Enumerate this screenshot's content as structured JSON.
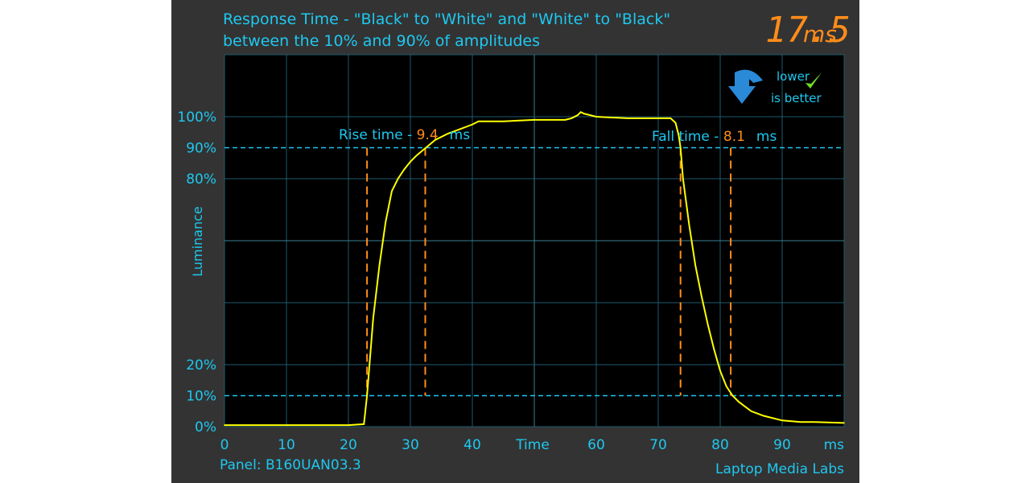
{
  "chart_data": {
    "type": "line",
    "title": "Response Time - \"Black\" to \"White\" and \"White\" to \"Black\"",
    "subtitle": "between the 10% and 90% of amplitudes",
    "xlabel": "Time",
    "xunit": "ms",
    "ylabel": "Luminance",
    "xlim": [
      0,
      100
    ],
    "ylim": [
      0,
      120
    ],
    "x_ticks": [
      "0",
      "10",
      "20",
      "30",
      "40",
      "60",
      "70",
      "80",
      "90"
    ],
    "y_ticks": [
      {
        "v": 0,
        "label": "0%"
      },
      {
        "v": 10,
        "label": "10%"
      },
      {
        "v": 20,
        "label": "20%"
      },
      {
        "v": 80,
        "label": "80%"
      },
      {
        "v": 90,
        "label": "90%"
      },
      {
        "v": 100,
        "label": "100%"
      }
    ],
    "grid": true,
    "threshold_lines": [
      10,
      90
    ],
    "series": [
      {
        "x": [
          0,
          5,
          10,
          15,
          20,
          22.5,
          23,
          24,
          25,
          26,
          27,
          28,
          29,
          30,
          31,
          32.5,
          34,
          36,
          38,
          40,
          41,
          45,
          50,
          55,
          56,
          57,
          57.5,
          58,
          60,
          65,
          70,
          72,
          72.8,
          73.3,
          73.6,
          74,
          75,
          76,
          77,
          78,
          79,
          80,
          81,
          82,
          83,
          85,
          87,
          90,
          93,
          95,
          100
        ],
        "y": [
          0.5,
          0.5,
          0.5,
          0.5,
          0.5,
          0.8,
          10,
          35,
          52,
          66,
          76,
          80,
          83,
          85.5,
          87.5,
          90,
          92.5,
          94.5,
          96,
          97.5,
          98.5,
          98.5,
          99,
          99,
          99.5,
          100.5,
          101.5,
          101,
          100,
          99.5,
          99.5,
          99.5,
          98,
          94,
          90,
          80,
          65,
          52,
          42,
          33,
          25,
          18,
          13,
          10,
          8,
          5,
          3.5,
          2,
          1.5,
          1.5,
          1.2
        ]
      }
    ],
    "annotations": {
      "rise": {
        "label": "Rise time - ",
        "value": "9.4",
        "unit": "ms",
        "start": 23,
        "end": 32.4
      },
      "fall": {
        "label": "Fall time - ",
        "value": "8.1",
        "unit": "ms",
        "start": 73.6,
        "end": 81.7
      }
    }
  },
  "total": {
    "value": "17.5",
    "unit": "ms"
  },
  "badge": {
    "line1": "lower",
    "line2": "is better"
  },
  "footer": {
    "panel": "Panel: B160UAN03.3",
    "brand": "Laptop Media Labs"
  },
  "colors": {
    "background": "#333333",
    "plot": "#000000",
    "grid": "#1d5a6e",
    "text": "#1ec8f0",
    "trace": "#ffff00",
    "marker": "#ff8c1a"
  }
}
